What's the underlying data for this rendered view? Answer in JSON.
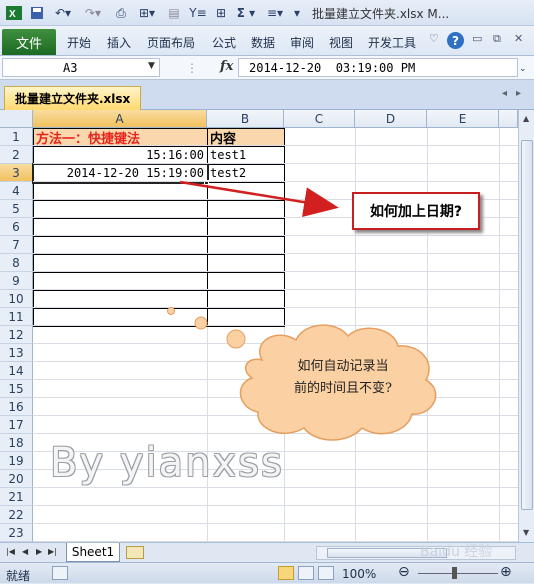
{
  "window": {
    "doc_title": "批量建立文件夹.xlsx M..."
  },
  "ribbon": {
    "file_tab": "文件",
    "tabs": [
      "开始",
      "插入",
      "页面布局",
      "公式",
      "数据",
      "审阅",
      "视图",
      "开发工具"
    ],
    "help": "?"
  },
  "formula_bar": {
    "name_box": "A3",
    "fx_label": "fx",
    "formula": "2014-12-20  03:19:00 PM"
  },
  "workbook_tab": "批量建立文件夹.xlsx",
  "grid": {
    "columns": [
      "A",
      "B",
      "C",
      "D",
      "E"
    ],
    "rows": [
      "1",
      "2",
      "3",
      "4",
      "5",
      "6",
      "7",
      "8",
      "9",
      "10",
      "11",
      "12",
      "13",
      "14",
      "15",
      "16",
      "17",
      "18",
      "19",
      "20",
      "21",
      "22",
      "23"
    ],
    "cells": {
      "A1": "方法一：快捷键法",
      "B1": "内容",
      "A2": "15:16:00",
      "B2": "test1",
      "A3": "2014-12-20 15:19:00",
      "B3": "test2"
    },
    "selected_cell": "A3",
    "colors": {
      "header_fill": "#fad7ac",
      "title_text": "#e8251d",
      "selection": "#222222"
    }
  },
  "annotations": {
    "callout": "如何加上日期?",
    "cloud_line1": "如何自动记录当",
    "cloud_line2": "前的时间且不变?",
    "watermark": "By yianxss",
    "baidu_mark": "Baidu 经验"
  },
  "sheets": [
    "Sheet1"
  ],
  "status": {
    "ready": "就绪",
    "zoom": "100%"
  }
}
